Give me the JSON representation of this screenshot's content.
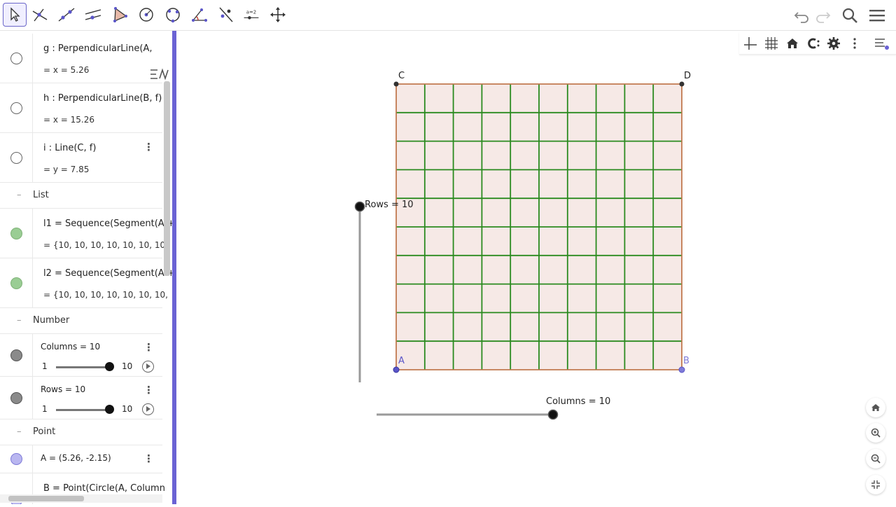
{
  "toolbar": {
    "tools": [
      {
        "name": "move-tool-icon",
        "selected": true
      },
      {
        "name": "line-through-point-icon"
      },
      {
        "name": "line-icon"
      },
      {
        "name": "parallel-line-icon"
      },
      {
        "name": "polygon-icon"
      },
      {
        "name": "circle-icon"
      },
      {
        "name": "circle-three-points-icon"
      },
      {
        "name": "angle-icon"
      },
      {
        "name": "reflect-icon"
      },
      {
        "name": "slider-icon",
        "label": "a=2"
      },
      {
        "name": "move-graphics-icon"
      }
    ]
  },
  "algebra": {
    "g_def": "g : PerpendicularLine(A, ",
    "g_val": "=  x = 5.26",
    "h_def": "h : PerpendicularLine(B, f)",
    "h_val": "=  x = 15.26",
    "i_def": "i : Line(C, f)",
    "i_val": "=  y = 7.85",
    "group_list": "List",
    "l1_def": "l1  =  Sequence(Segment(A +",
    "l1_val": "=  {10, 10, 10, 10, 10, 10, 10,",
    "l2_def": "l2  =  Sequence(Segment(A +",
    "l2_val": "=  {10, 10, 10, 10, 10, 10, 10,",
    "group_number": "Number",
    "columns_def": "Columns  =  10",
    "columns_min": "1",
    "columns_max": "10",
    "columns_value": 10,
    "rows_def": "Rows  =  10",
    "rows_min": "1",
    "rows_max": "10",
    "rows_value": 10,
    "group_point": "Point",
    "a_def": "A  =  (5.26, -2.15)",
    "b_def": "B  =  Point(Circle(A, Column"
  },
  "graphics": {
    "label_c": "C",
    "label_d": "D",
    "label_a": "A",
    "label_b": "B",
    "rows_slider_label": "Rows = 10",
    "columns_slider_label": "Columns = 10",
    "rows": 10,
    "columns": 10,
    "colors": {
      "grid_fill": "#f6e9e6",
      "grid_line": "#2a8a1f",
      "border": "#c17a50",
      "point_blue": "#5a55c8",
      "divider": "#6a62d4"
    }
  }
}
